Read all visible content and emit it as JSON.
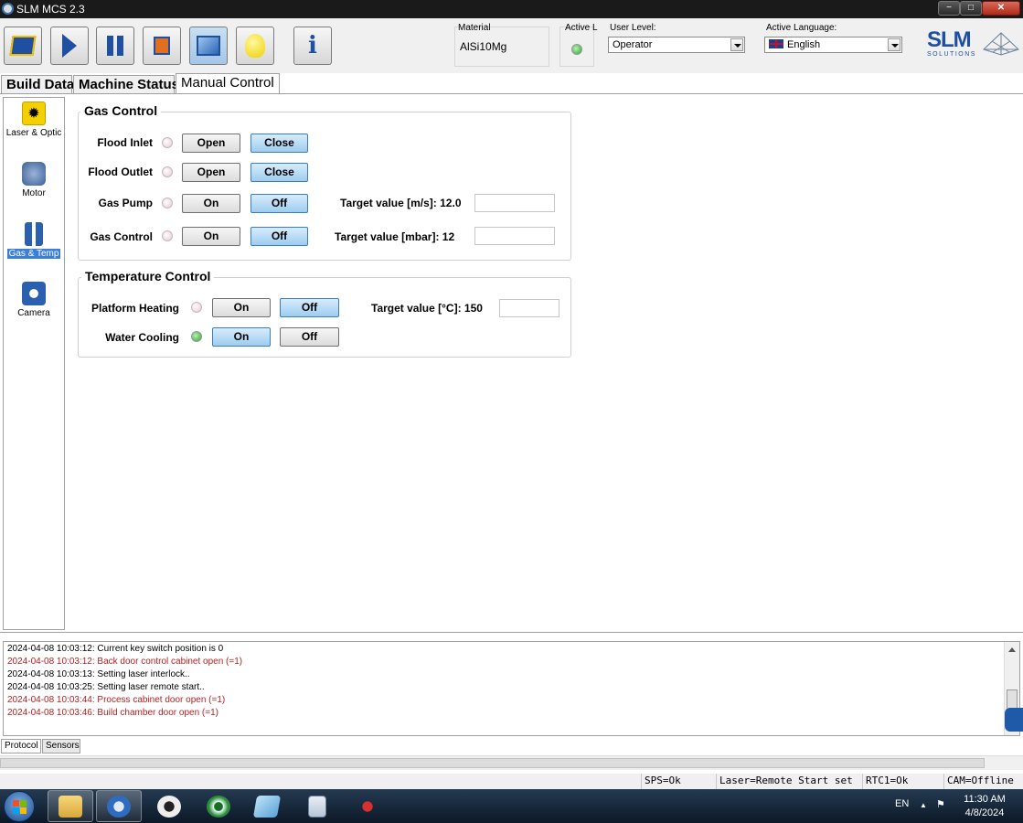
{
  "window": {
    "title": "SLM MCS 2.3",
    "min": "−",
    "max": "□",
    "close": "✕"
  },
  "toolbar": {
    "buttons": [
      "open-build-icon",
      "start-icon",
      "pause-icon",
      "stop-icon",
      "screen-icon",
      "light-icon",
      "info-icon"
    ],
    "material_label": "Material",
    "material_value": "AlSi10Mg",
    "active_label": "Active L",
    "user_level_label": "User Level:",
    "user_level_value": "Operator",
    "language_label": "Active Language:",
    "language_value": "English",
    "logo_text": "SLM",
    "logo_sub": "SOLUTIONS"
  },
  "tabs": [
    "Build Data",
    "Machine Status",
    "Manual Control"
  ],
  "active_tab": "Manual Control",
  "leftnav": [
    {
      "label": "Laser & Optic",
      "icon": "laser-icon"
    },
    {
      "label": "Motor",
      "icon": "motor-icon"
    },
    {
      "label": "Gas & Temp",
      "icon": "gas-temp-icon",
      "active": true
    },
    {
      "label": "Camera",
      "icon": "camera-icon"
    }
  ],
  "gas_control": {
    "title": "Gas Control",
    "rows": [
      {
        "label": "Flood Inlet",
        "btn1": "Open",
        "btn2": "Close",
        "selected": 2,
        "led": "off"
      },
      {
        "label": "Flood Outlet",
        "btn1": "Open",
        "btn2": "Close",
        "selected": 2,
        "led": "off"
      },
      {
        "label": "Gas Pump",
        "btn1": "On",
        "btn2": "Off",
        "selected": 2,
        "led": "off",
        "target": "Target value [m/s]: 12.0",
        "input": ""
      },
      {
        "label": "Gas Control",
        "btn1": "On",
        "btn2": "Off",
        "selected": 2,
        "led": "off",
        "target": "Target value [mbar]: 12",
        "input": ""
      }
    ]
  },
  "temperature_control": {
    "title": "Temperature Control",
    "rows": [
      {
        "label": "Platform Heating",
        "btn1": "On",
        "btn2": "Off",
        "selected": 2,
        "led": "off",
        "target": "Target value [°C]: 150",
        "input": ""
      },
      {
        "label": "Water Cooling",
        "btn1": "On",
        "btn2": "Off",
        "selected": 1,
        "led": "green"
      }
    ]
  },
  "log": [
    {
      "text": "2024-04-08 10:03:12: Current key switch position is 0",
      "level": "info"
    },
    {
      "text": "2024-04-08 10:03:12: Back door control cabinet open (=1)",
      "level": "warn"
    },
    {
      "text": "2024-04-08 10:03:13: Setting laser interlock..",
      "level": "info"
    },
    {
      "text": "2024-04-08 10:03:25: Setting laser remote start..",
      "level": "info"
    },
    {
      "text": "2024-04-08 10:03:44: Process cabinet door open (=1)",
      "level": "warn"
    },
    {
      "text": "2024-04-08 10:03:46: Build chamber door open (=1)",
      "level": "warn"
    }
  ],
  "log_tabs": [
    "Protocol",
    "Sensors"
  ],
  "status": [
    "SPS=Ok",
    "Laser=Remote Start set",
    "RTC1=Ok",
    "CAM=Offline"
  ],
  "taskbar": {
    "apps": [
      "file-explorer-icon",
      "slm-mcs-icon",
      "camera-app-icon",
      "viewer-app-icon",
      "notes-app-icon",
      "calculator-icon",
      "tools-app-icon"
    ],
    "lang": "EN",
    "time": "11:30 AM",
    "date": "4/8/2024"
  },
  "colors": {
    "accent": "#1e4fa0",
    "selected_button": "#9dcdf0",
    "warn_text": "#b51f1f",
    "led_on": "#2aa52a"
  }
}
